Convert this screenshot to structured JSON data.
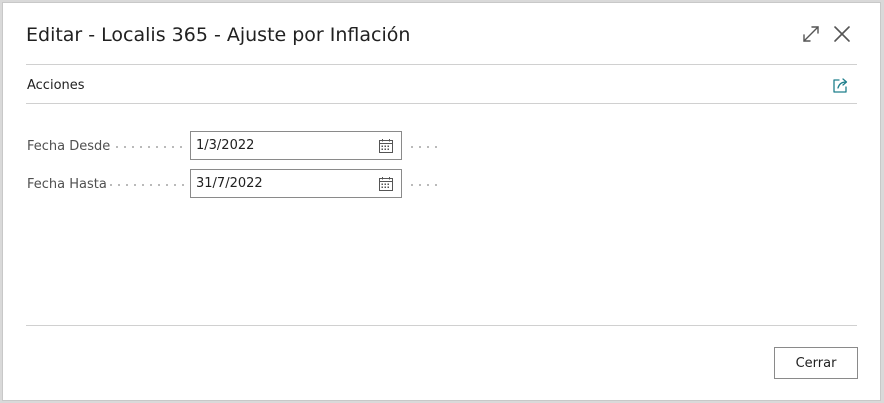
{
  "dialog": {
    "title": "Editar - Localis 365 - Ajuste por Inflación",
    "actions_label": "Acciones"
  },
  "fields": [
    {
      "label": "Fecha Desde",
      "value": "1/3/2022"
    },
    {
      "label": "Fecha Hasta",
      "value": "31/7/2022"
    }
  ],
  "footer": {
    "close_label": "Cerrar"
  },
  "icons": {
    "expand": "expand-icon",
    "close": "close-icon",
    "share": "share-icon",
    "calendar": "calendar-icon"
  },
  "colors": {
    "accent": "#1f7f8c",
    "text": "#212121",
    "muted": "#505050"
  }
}
